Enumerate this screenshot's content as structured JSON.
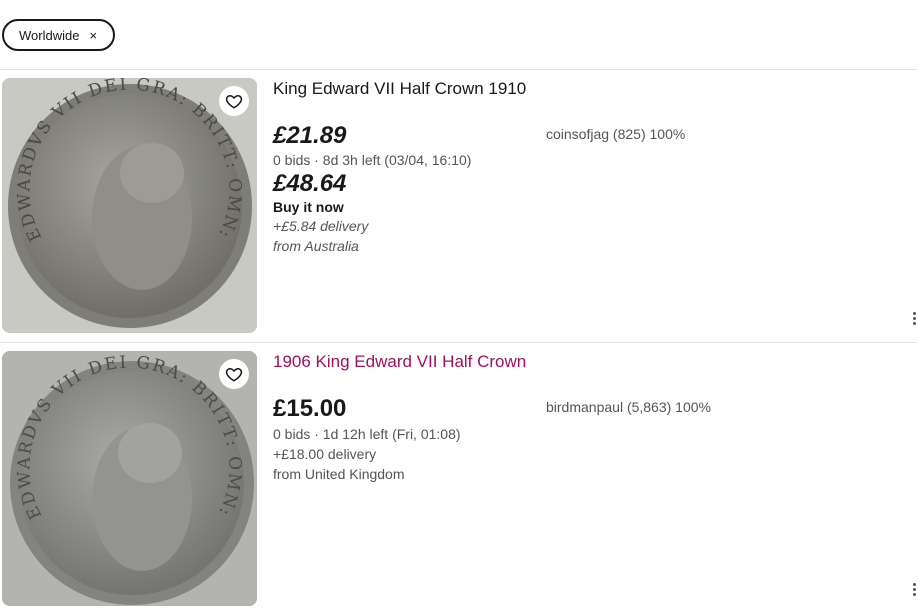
{
  "filter_chip": {
    "label": "Worldwide",
    "remove": "×"
  },
  "listings": [
    {
      "title": "King Edward VII Half Crown 1910",
      "price_bid": "£21.89",
      "bids_info": "0 bids · 8d 3h left (03/04, 16:10)",
      "price_buy": "£48.64",
      "buy_label": "Buy it now",
      "delivery": "+£5.84 delivery",
      "origin": "from Australia",
      "seller": "coinsofjag (825) 100%",
      "coin_legend": "EDWARDVS VII DEI GRA: BRITT: OMN: REX",
      "image_icon": "coin-photo",
      "colors": {
        "coin": "#8d8c87",
        "background": "#c9c9c4"
      }
    },
    {
      "title": "1906 King Edward VII Half Crown",
      "price_bid": "£15.00",
      "bids_info": "0 bids · 1d 12h left (Fri, 01:08)",
      "delivery": "+£18.00 delivery",
      "origin": "from United Kingdom",
      "seller": "birdmanpaul (5,863) 100%",
      "coin_legend": "EDWARDVS VII DEI GRA: BRITT: OMN: REX",
      "image_icon": "coin-photo",
      "colors": {
        "coin": "#8a8a87",
        "background": "#b3b3b0"
      }
    }
  ],
  "colors": {
    "title_visited": "#a0105f",
    "text": "#191919",
    "secondary": "#555555"
  }
}
